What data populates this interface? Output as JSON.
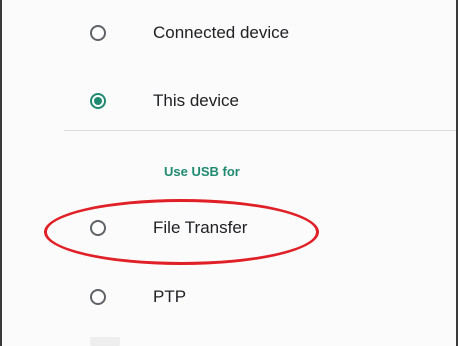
{
  "usb_settings": {
    "power_options": [
      {
        "label": "Connected device",
        "selected": false
      },
      {
        "label": "This device",
        "selected": true
      }
    ],
    "section_header": "Use USB for",
    "usb_options": [
      {
        "label": "File Transfer",
        "selected": false,
        "highlighted": true
      },
      {
        "label": "PTP",
        "selected": false
      }
    ]
  },
  "colors": {
    "accent": "#1f8a70",
    "annotation": "#e01f26"
  }
}
